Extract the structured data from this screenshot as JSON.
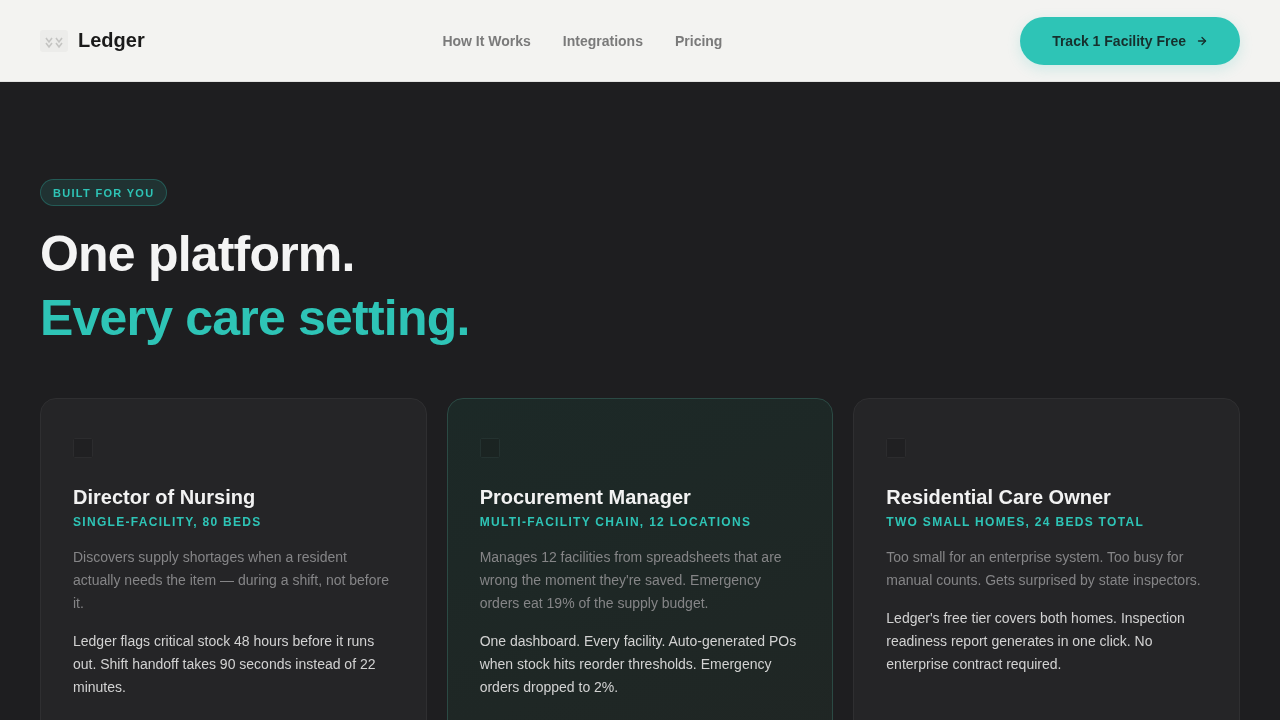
{
  "nav": {
    "brand": "Ledger",
    "links": [
      "How It Works",
      "Integrations",
      "Pricing"
    ],
    "cta": "Track 1 Facility Free"
  },
  "hero": {
    "badge": "BUILT FOR YOU",
    "title": "One platform.",
    "title_accent": "Every care setting."
  },
  "cards": [
    {
      "title": "Director of Nursing",
      "subtitle": "SINGLE-FACILITY, 80 BEDS",
      "problem": "Discovers supply shortages when a resident actually needs the item — during a shift, not before it.",
      "solution": "Ledger flags critical stock 48 hours before it runs out. Shift handoff takes 90 seconds instead of 22 minutes.",
      "featured": false
    },
    {
      "title": "Procurement Manager",
      "subtitle": "MULTI-FACILITY CHAIN, 12 LOCATIONS",
      "problem": "Manages 12 facilities from spreadsheets that are wrong the moment they're saved. Emergency orders eat 19% of the supply budget.",
      "solution": "One dashboard. Every facility. Auto-generated POs when stock hits reorder thresholds. Emergency orders dropped to 2%.",
      "featured": true
    },
    {
      "title": "Residential Care Owner",
      "subtitle": "TWO SMALL HOMES, 24 BEDS TOTAL",
      "problem": "Too small for an enterprise system. Too busy for manual counts. Gets surprised by state inspectors.",
      "solution": "Ledger's free tier covers both homes. Inspection readiness report generates in one click. No enterprise contract required.",
      "featured": false
    }
  ]
}
